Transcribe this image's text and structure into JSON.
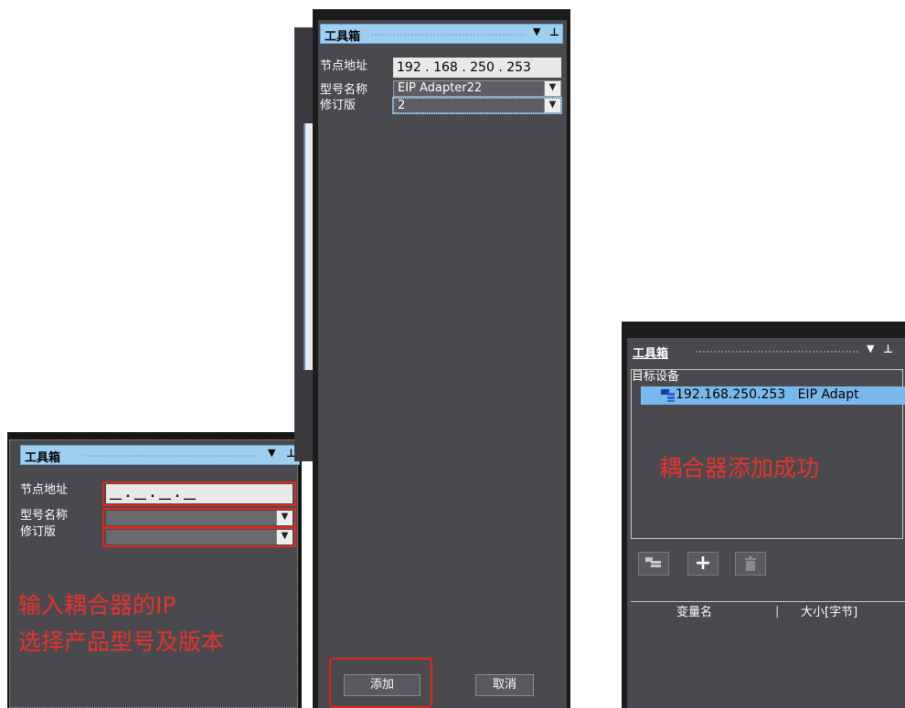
{
  "panel_left": {
    "title": "工具箱",
    "node_address_label": "节点地址",
    "model_label": "型号名称",
    "revision_label": "修订版",
    "ip_placeholder": "__ . __ . __ . __",
    "annotation_line1": "输入耦合器的IP",
    "annotation_line2": "选择产品型号及版本"
  },
  "panel_mid": {
    "title": "工具箱",
    "node_address_label": "节点地址",
    "model_label": "型号名称",
    "revision_label": "修订版",
    "ip_value": "192 . 168 . 250 . 253",
    "model_value": "EIP Adapter22",
    "revision_value": "2",
    "add_label": "添加",
    "cancel_label": "取消"
  },
  "panel_right": {
    "title": "工具箱",
    "target_device_label": "目标设备",
    "device_entry": "192.168.250.253   EIP Adapt",
    "success_message": "耦合器添加成功",
    "var_name_header": "变量名",
    "size_header": "大小[字节]"
  },
  "colors": {
    "panel_bg": "#4a4a4e",
    "title_bg": "#9ecff0",
    "annotation_red": "#e8322a",
    "selection_blue": "#79b8eb"
  },
  "icons": [
    "dropdown-arrow-icon",
    "pin-icon",
    "network-device-icon",
    "add-icon",
    "delete-icon"
  ]
}
